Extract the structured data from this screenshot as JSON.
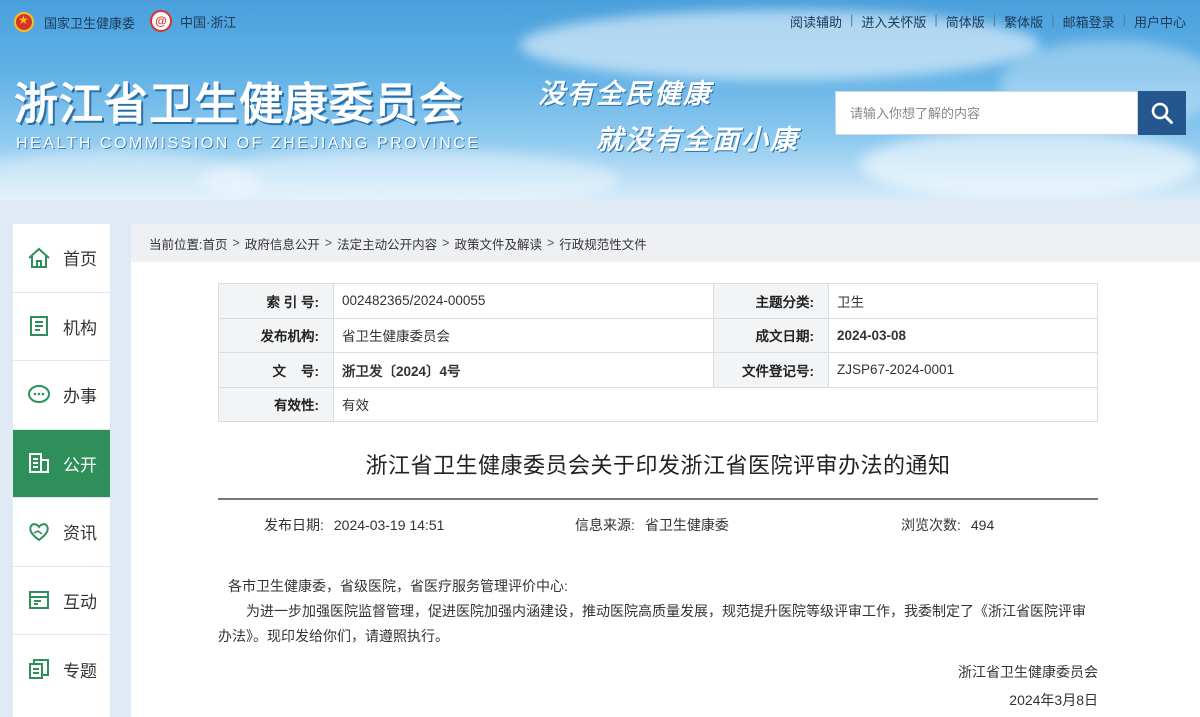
{
  "header": {
    "nhc_label": "国家卫生健康委",
    "zj_label": "中国·浙江",
    "links": [
      "阅读辅助",
      "进入关怀版",
      "简体版",
      "繁体版",
      "邮箱登录",
      "用户中心"
    ],
    "title_cn": "浙江省卫生健康委员会",
    "title_en": "HEALTH COMMISSION OF ZHEJIANG PROVINCE",
    "slogan_line1": "没有全民健康",
    "slogan_line2": "就没有全面小康",
    "search_placeholder": "请输入你想了解的内容"
  },
  "nav": {
    "items": [
      {
        "label": "首页",
        "icon": "home-icon"
      },
      {
        "label": "机构",
        "icon": "document-icon"
      },
      {
        "label": "办事",
        "icon": "chat-icon"
      },
      {
        "label": "公开",
        "icon": "building-icon",
        "active": true
      },
      {
        "label": "资讯",
        "icon": "heart-hands-icon"
      },
      {
        "label": "互动",
        "icon": "message-board-icon"
      },
      {
        "label": "专题",
        "icon": "pages-icon"
      }
    ],
    "active_color": "#2f8f5b"
  },
  "breadcrumb": {
    "prefix": "当前位置:",
    "items": [
      "首页",
      "政府信息公开",
      "法定主动公开内容",
      "政策文件及解读",
      "行政规范性文件"
    ]
  },
  "meta": {
    "index_no_label": "索 引 号:",
    "index_no": "002482365/2024-00055",
    "topic_label": "主题分类:",
    "topic": "卫生",
    "issuer_label": "发布机构:",
    "issuer": "省卫生健康委员会",
    "date_label": "成文日期:",
    "date": "2024-03-08",
    "doc_no_label": "文    号:",
    "doc_no": "浙卫发〔2024〕4号",
    "reg_label": "文件登记号:",
    "reg_no": "ZJSP67-2024-0001",
    "validity_label": "有效性:",
    "validity": "有效"
  },
  "article": {
    "title": "浙江省卫生健康委员会关于印发浙江省医院评审办法的通知",
    "publish_label": "发布日期:",
    "publish_date": "2024-03-19 14:51",
    "source_label": "信息来源:",
    "source": "省卫生健康委",
    "views_label": "浏览次数:",
    "views": "494",
    "salutation": "各市卫生健康委，省级医院，省医疗服务管理评价中心:",
    "paragraph": "为进一步加强医院监督管理，促进医院加强内涵建设，推动医院高质量发展，规范提升医院等级评审工作，我委制定了《浙江省医院评审办法》。现印发给你们，请遵照执行。",
    "signature": "浙江省卫生健康委员会",
    "sign_date": "2024年3月8日"
  },
  "colors": {
    "header_blue": "#4aa0dc",
    "search_button": "#23578e",
    "nav_active": "#2f8f5b",
    "page_bg": "#dfeaf5"
  }
}
